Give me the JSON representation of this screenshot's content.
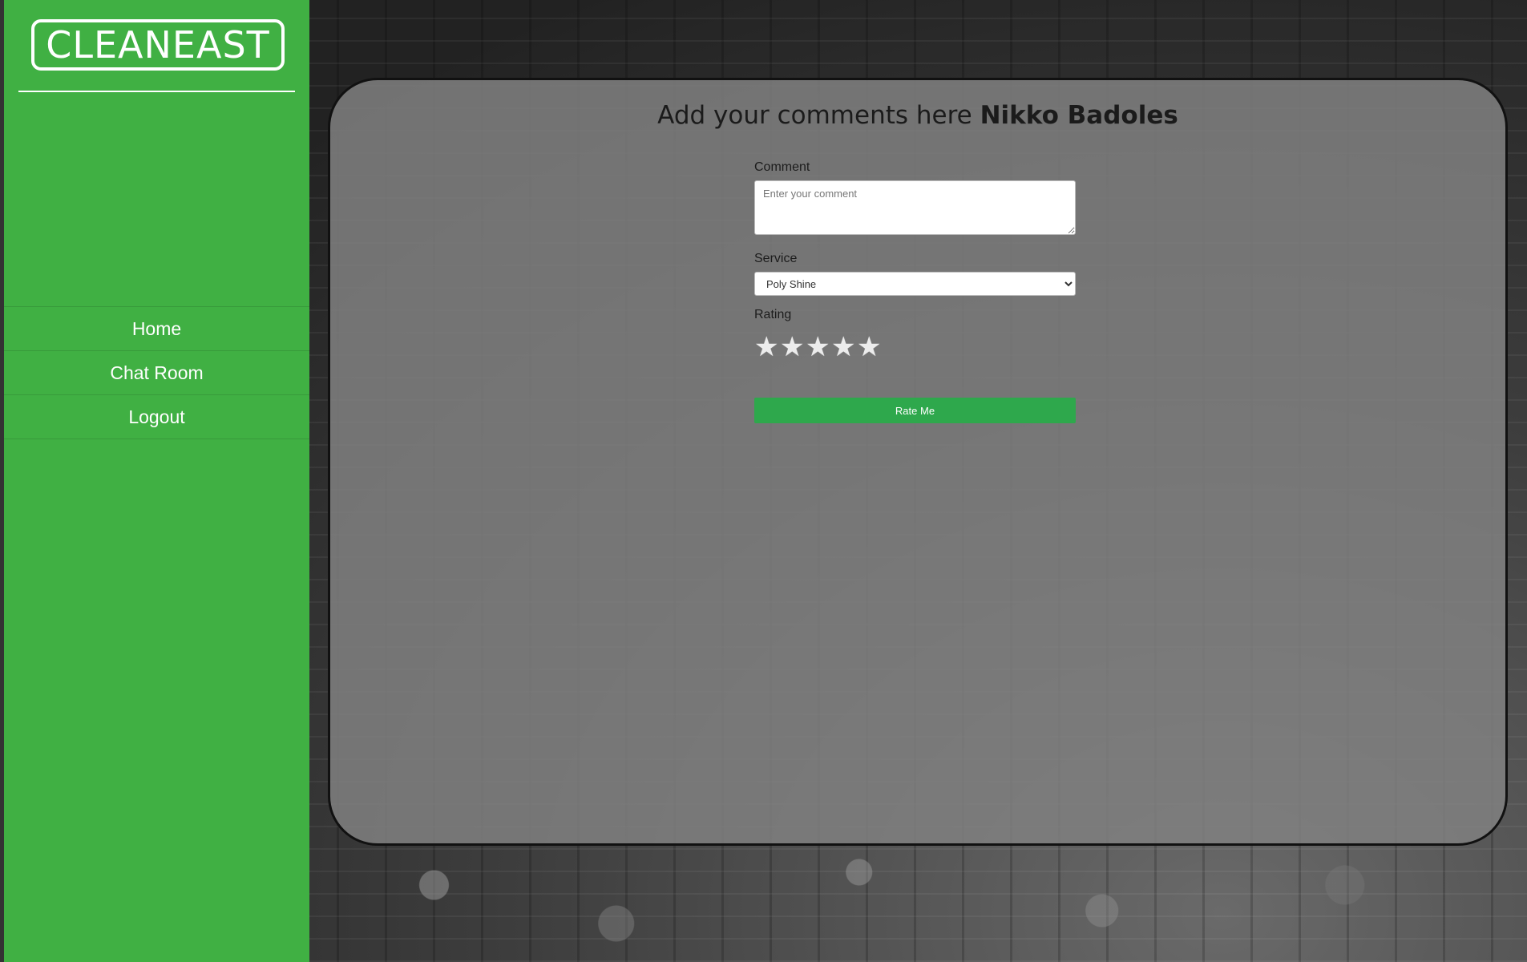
{
  "sidebar": {
    "logo_text": "CLEANEAST",
    "nav": [
      {
        "label": "Home"
      },
      {
        "label": "Chat Room"
      },
      {
        "label": "Logout"
      }
    ],
    "bg_color": "#40b043"
  },
  "main": {
    "heading_prefix": "Add your comments here",
    "user_name": "Nikko Badoles",
    "comment": {
      "label": "Comment",
      "placeholder": "Enter your comment",
      "value": ""
    },
    "service": {
      "label": "Service",
      "selected": "Poly Shine"
    },
    "rating": {
      "label": "Rating",
      "stars_total": 5,
      "stars_filled": 0,
      "star_glyph": "★"
    },
    "submit_label": "Rate Me",
    "accent_color": "#2ea84c"
  }
}
